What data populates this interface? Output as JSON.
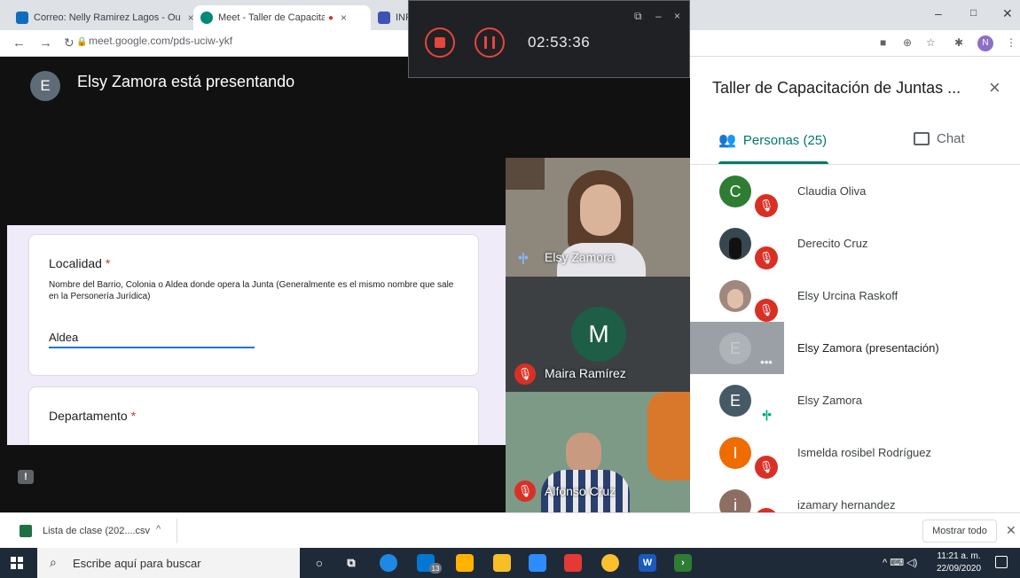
{
  "browser": {
    "tabs": [
      {
        "label": "Correo: Nelly Ramirez Lagos - Ou",
        "close": "×",
        "color": "#0f6cbd"
      },
      {
        "label": "Meet - Taller de Capacitación",
        "close": "×",
        "color": "#00897b",
        "recording_dot": "●"
      },
      {
        "label": "INF",
        "color": "#3f51b5"
      }
    ],
    "url": "meet.google.com/pds-uciw-ykf",
    "lock_icon": "lock-icon",
    "window_controls": [
      "–",
      "□",
      "✕"
    ]
  },
  "recorder": {
    "time": "02:53:36",
    "popout_glyph": "⧉",
    "minimize_glyph": "–",
    "close_glyph": "×"
  },
  "meet": {
    "presenter_initial": "E",
    "presenter_text": "Elsy Zamora está presentando",
    "form": {
      "q1_title": "Localidad",
      "q1_required": "*",
      "q1_desc": "Nombre del Barrio, Colonia o Aldea donde opera la Junta (Generalmente es el mismo nombre que sale en la Personería Jurídica)",
      "q1_answer": "Aldea",
      "q2_title": "Departamento",
      "q2_required": "*"
    },
    "tiles": [
      {
        "name": "Elsy Zamora",
        "state": "speaking"
      },
      {
        "name": "Maira Ramírez",
        "initial": "M",
        "state": "muted"
      },
      {
        "name": "Alfonso Cruz",
        "state": "muted"
      }
    ]
  },
  "panel": {
    "title": "Taller de Capacitación de Juntas ...",
    "close": "×",
    "people_tab": "Personas (25)",
    "chat_tab": "Chat",
    "participants": [
      {
        "name": "Claudia Oliva",
        "initial": "C",
        "color": "#2e7d32",
        "state": "muted"
      },
      {
        "name": "Derecito Cruz",
        "initial": "",
        "color": "#37474f",
        "state": "muted"
      },
      {
        "name": "Elsy Urcina Raskoff",
        "initial": "",
        "color": "#a1887f",
        "state": "muted"
      },
      {
        "name": "Elsy Zamora (presentación)",
        "initial": "E",
        "color": "#80868b",
        "state": "presenting"
      },
      {
        "name": "Elsy Zamora",
        "initial": "E",
        "color": "#455a64",
        "state": "speaking"
      },
      {
        "name": "Ismelda rosibel Rodríguez",
        "initial": "I",
        "color": "#ef6c00",
        "state": "muted"
      },
      {
        "name": "izamary hernandez",
        "initial": "i",
        "color": "#8d6e63",
        "state": "muted"
      }
    ]
  },
  "downloads": {
    "file": "Lista de clase (202....csv",
    "arrow": "^",
    "show_all": "Mostrar todo",
    "close": "✕"
  },
  "taskbar": {
    "search_placeholder": "Escribe aquí para buscar",
    "time": "11:21 a. m.",
    "date": "22/09/2020",
    "badge": "13",
    "tray": "^ ⌨ ◁)"
  }
}
